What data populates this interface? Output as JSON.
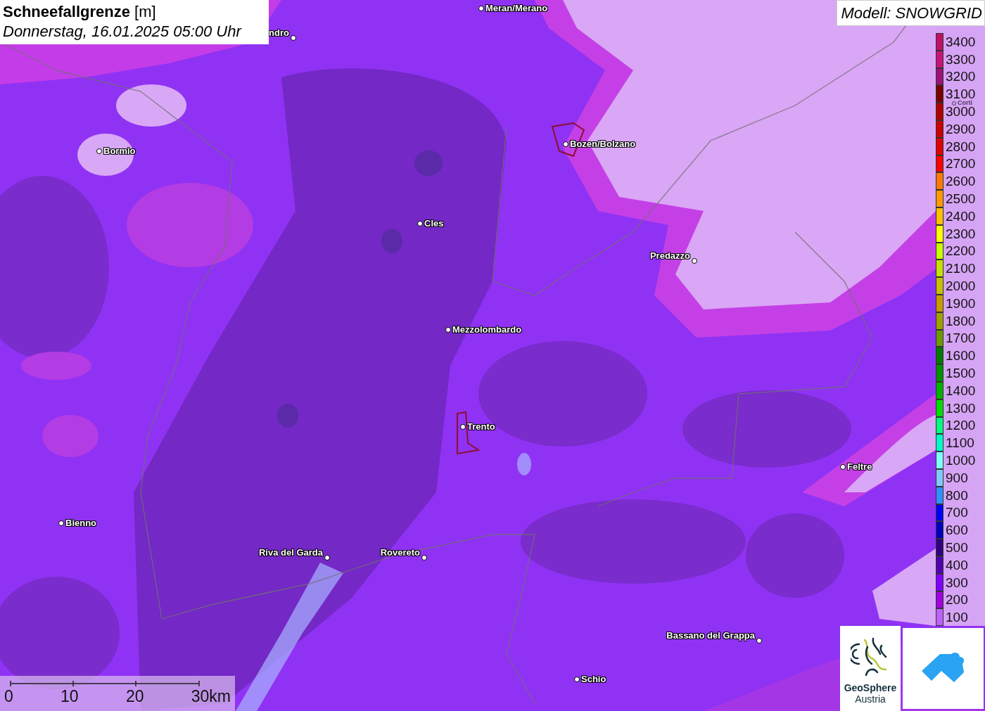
{
  "title": {
    "heading": "**Schneefallgrenze** [m]",
    "date": "Donnerstag, 16.01.2025 05:00 Uhr"
  },
  "model_label": "Modell: SNOWGRID",
  "towns": [
    {
      "name": "Meran/Merano",
      "dimmed": false
    },
    {
      "name": "ndro",
      "dimmed": false
    },
    {
      "name": "Bormio",
      "dimmed": false
    },
    {
      "name": "Bozen/Bolzano",
      "dimmed": false
    },
    {
      "name": "Cles",
      "dimmed": false
    },
    {
      "name": "Predazzo",
      "dimmed": false
    },
    {
      "name": "Mezzolombardo",
      "dimmed": false
    },
    {
      "name": "Trento",
      "dimmed": false
    },
    {
      "name": "Feltre",
      "dimmed": false
    },
    {
      "name": "Bienno",
      "dimmed": false
    },
    {
      "name": "Riva del Garda",
      "dimmed": false
    },
    {
      "name": "Rovereto",
      "dimmed": false
    },
    {
      "name": "Bassano del Grappa",
      "dimmed": false
    },
    {
      "name": "Schio",
      "dimmed": false
    },
    {
      "name": "Corti",
      "dimmed": true
    }
  ],
  "legend": {
    "items": [
      {
        "label": "3400",
        "color": "#c0106a"
      },
      {
        "label": "3300",
        "color": "#c8147a"
      },
      {
        "label": "3200",
        "color": "#a0107a"
      },
      {
        "label": "3100",
        "color": "#7a0000"
      },
      {
        "label": "3000",
        "color": "#b00000"
      },
      {
        "label": "2900",
        "color": "#cc0000"
      },
      {
        "label": "2800",
        "color": "#e00000"
      },
      {
        "label": "2700",
        "color": "#ff0000"
      },
      {
        "label": "2600",
        "color": "#ff7a00"
      },
      {
        "label": "2500",
        "color": "#ff9a00"
      },
      {
        "label": "2400",
        "color": "#ffc000"
      },
      {
        "label": "2300",
        "color": "#ffff00"
      },
      {
        "label": "2200",
        "color": "#c8ff00"
      },
      {
        "label": "2100",
        "color": "#c8e000"
      },
      {
        "label": "2000",
        "color": "#c8c000"
      },
      {
        "label": "1900",
        "color": "#c89c00"
      },
      {
        "label": "1800",
        "color": "#a0a000"
      },
      {
        "label": "1700",
        "color": "#6a9a00"
      },
      {
        "label": "1600",
        "color": "#007a00"
      },
      {
        "label": "1500",
        "color": "#009000"
      },
      {
        "label": "1400",
        "color": "#00b000"
      },
      {
        "label": "1300",
        "color": "#00e000"
      },
      {
        "label": "1200",
        "color": "#00ff80"
      },
      {
        "label": "1100",
        "color": "#00ffc8"
      },
      {
        "label": "1000",
        "color": "#80ffff"
      },
      {
        "label": "900",
        "color": "#80c8ff"
      },
      {
        "label": "800",
        "color": "#3090ff"
      },
      {
        "label": "700",
        "color": "#0000ff"
      },
      {
        "label": "600",
        "color": "#0000c0"
      },
      {
        "label": "500",
        "color": "#300080"
      },
      {
        "label": "400",
        "color": "#5000b0"
      },
      {
        "label": "300",
        "color": "#8000ff"
      },
      {
        "label": "200",
        "color": "#a000e0"
      },
      {
        "label": "100",
        "color": "#c060ff"
      }
    ]
  },
  "scale_bar": {
    "labels": [
      "0",
      "10",
      "20",
      "30km"
    ]
  },
  "logos": {
    "geosphere": [
      "GeoSphere",
      "Austria"
    ]
  }
}
